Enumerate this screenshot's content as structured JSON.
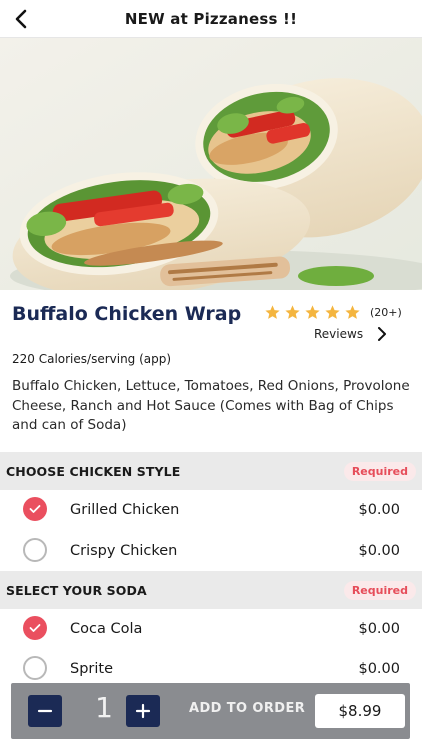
{
  "header": {
    "title": "NEW at Pizzaness !!",
    "back_icon": "chevron-left-icon"
  },
  "item": {
    "title": "Buffalo Chicken Wrap",
    "rating_stars": 5,
    "rating_count": "(20+)",
    "reviews_label": "Reviews",
    "calories": "220 Calories/serving (app)",
    "description": "Buffalo Chicken, Lettuce, Tomatoes, Red Onions, Provolone Cheese, Ranch and Hot Sauce (Comes with Bag of Chips and can of Soda)"
  },
  "sections": [
    {
      "title": "CHOOSE CHICKEN STYLE",
      "badge": "Required",
      "options": [
        {
          "label": "Grilled Chicken",
          "price": "$0.00",
          "selected": true
        },
        {
          "label": "Crispy Chicken",
          "price": "$0.00",
          "selected": false
        }
      ]
    },
    {
      "title": "SELECT YOUR SODA",
      "badge": "Required",
      "options": [
        {
          "label": "Coca Cola",
          "price": "$0.00",
          "selected": true
        },
        {
          "label": "Sprite",
          "price": "$0.00",
          "selected": false
        }
      ]
    }
  ],
  "order": {
    "quantity": "1",
    "add_label": "ADD TO ORDER",
    "price": "$8.99"
  },
  "colors": {
    "accent": "#ea4f5f",
    "brand_navy": "#1b2a55",
    "star": "#f4b53f",
    "order_bar": "#8a8c90"
  }
}
